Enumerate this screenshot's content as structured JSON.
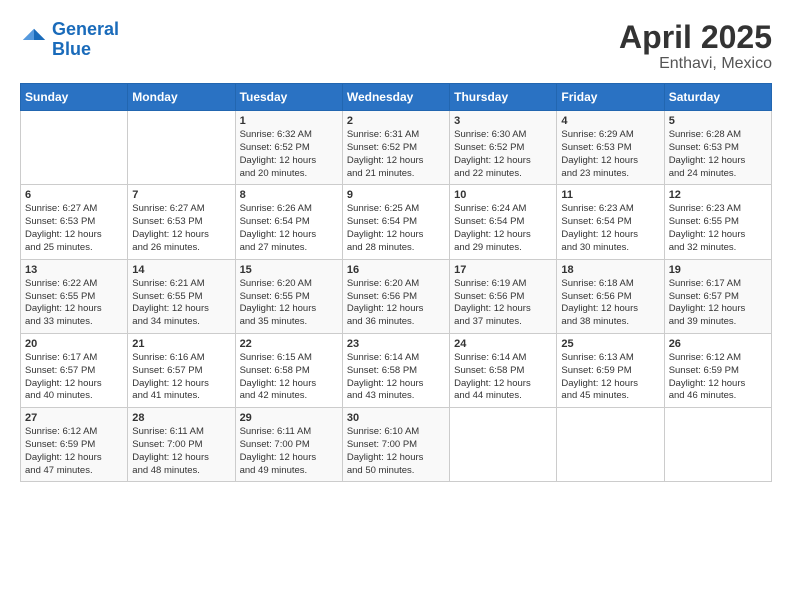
{
  "header": {
    "logo_line1": "General",
    "logo_line2": "Blue",
    "title": "April 2025",
    "subtitle": "Enthavi, Mexico"
  },
  "calendar": {
    "days_of_week": [
      "Sunday",
      "Monday",
      "Tuesday",
      "Wednesday",
      "Thursday",
      "Friday",
      "Saturday"
    ],
    "weeks": [
      [
        {
          "day": "",
          "info": ""
        },
        {
          "day": "",
          "info": ""
        },
        {
          "day": "1",
          "info": "Sunrise: 6:32 AM\nSunset: 6:52 PM\nDaylight: 12 hours\nand 20 minutes."
        },
        {
          "day": "2",
          "info": "Sunrise: 6:31 AM\nSunset: 6:52 PM\nDaylight: 12 hours\nand 21 minutes."
        },
        {
          "day": "3",
          "info": "Sunrise: 6:30 AM\nSunset: 6:52 PM\nDaylight: 12 hours\nand 22 minutes."
        },
        {
          "day": "4",
          "info": "Sunrise: 6:29 AM\nSunset: 6:53 PM\nDaylight: 12 hours\nand 23 minutes."
        },
        {
          "day": "5",
          "info": "Sunrise: 6:28 AM\nSunset: 6:53 PM\nDaylight: 12 hours\nand 24 minutes."
        }
      ],
      [
        {
          "day": "6",
          "info": "Sunrise: 6:27 AM\nSunset: 6:53 PM\nDaylight: 12 hours\nand 25 minutes."
        },
        {
          "day": "7",
          "info": "Sunrise: 6:27 AM\nSunset: 6:53 PM\nDaylight: 12 hours\nand 26 minutes."
        },
        {
          "day": "8",
          "info": "Sunrise: 6:26 AM\nSunset: 6:54 PM\nDaylight: 12 hours\nand 27 minutes."
        },
        {
          "day": "9",
          "info": "Sunrise: 6:25 AM\nSunset: 6:54 PM\nDaylight: 12 hours\nand 28 minutes."
        },
        {
          "day": "10",
          "info": "Sunrise: 6:24 AM\nSunset: 6:54 PM\nDaylight: 12 hours\nand 29 minutes."
        },
        {
          "day": "11",
          "info": "Sunrise: 6:23 AM\nSunset: 6:54 PM\nDaylight: 12 hours\nand 30 minutes."
        },
        {
          "day": "12",
          "info": "Sunrise: 6:23 AM\nSunset: 6:55 PM\nDaylight: 12 hours\nand 32 minutes."
        }
      ],
      [
        {
          "day": "13",
          "info": "Sunrise: 6:22 AM\nSunset: 6:55 PM\nDaylight: 12 hours\nand 33 minutes."
        },
        {
          "day": "14",
          "info": "Sunrise: 6:21 AM\nSunset: 6:55 PM\nDaylight: 12 hours\nand 34 minutes."
        },
        {
          "day": "15",
          "info": "Sunrise: 6:20 AM\nSunset: 6:55 PM\nDaylight: 12 hours\nand 35 minutes."
        },
        {
          "day": "16",
          "info": "Sunrise: 6:20 AM\nSunset: 6:56 PM\nDaylight: 12 hours\nand 36 minutes."
        },
        {
          "day": "17",
          "info": "Sunrise: 6:19 AM\nSunset: 6:56 PM\nDaylight: 12 hours\nand 37 minutes."
        },
        {
          "day": "18",
          "info": "Sunrise: 6:18 AM\nSunset: 6:56 PM\nDaylight: 12 hours\nand 38 minutes."
        },
        {
          "day": "19",
          "info": "Sunrise: 6:17 AM\nSunset: 6:57 PM\nDaylight: 12 hours\nand 39 minutes."
        }
      ],
      [
        {
          "day": "20",
          "info": "Sunrise: 6:17 AM\nSunset: 6:57 PM\nDaylight: 12 hours\nand 40 minutes."
        },
        {
          "day": "21",
          "info": "Sunrise: 6:16 AM\nSunset: 6:57 PM\nDaylight: 12 hours\nand 41 minutes."
        },
        {
          "day": "22",
          "info": "Sunrise: 6:15 AM\nSunset: 6:58 PM\nDaylight: 12 hours\nand 42 minutes."
        },
        {
          "day": "23",
          "info": "Sunrise: 6:14 AM\nSunset: 6:58 PM\nDaylight: 12 hours\nand 43 minutes."
        },
        {
          "day": "24",
          "info": "Sunrise: 6:14 AM\nSunset: 6:58 PM\nDaylight: 12 hours\nand 44 minutes."
        },
        {
          "day": "25",
          "info": "Sunrise: 6:13 AM\nSunset: 6:59 PM\nDaylight: 12 hours\nand 45 minutes."
        },
        {
          "day": "26",
          "info": "Sunrise: 6:12 AM\nSunset: 6:59 PM\nDaylight: 12 hours\nand 46 minutes."
        }
      ],
      [
        {
          "day": "27",
          "info": "Sunrise: 6:12 AM\nSunset: 6:59 PM\nDaylight: 12 hours\nand 47 minutes."
        },
        {
          "day": "28",
          "info": "Sunrise: 6:11 AM\nSunset: 7:00 PM\nDaylight: 12 hours\nand 48 minutes."
        },
        {
          "day": "29",
          "info": "Sunrise: 6:11 AM\nSunset: 7:00 PM\nDaylight: 12 hours\nand 49 minutes."
        },
        {
          "day": "30",
          "info": "Sunrise: 6:10 AM\nSunset: 7:00 PM\nDaylight: 12 hours\nand 50 minutes."
        },
        {
          "day": "",
          "info": ""
        },
        {
          "day": "",
          "info": ""
        },
        {
          "day": "",
          "info": ""
        }
      ]
    ]
  }
}
